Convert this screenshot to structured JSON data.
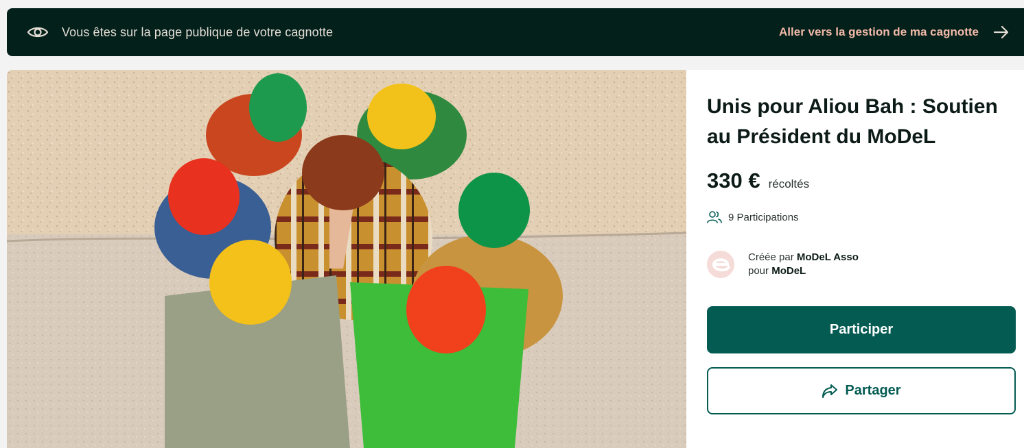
{
  "banner": {
    "message": "Vous êtes sur la page publique de votre cagnotte",
    "manage_link": "Aller vers la gestion de ma cagnotte",
    "icons": {
      "left": "eye-icon",
      "right": "arrow-right-icon"
    }
  },
  "hero": {
    "image": "group-in-colorful-bucket-hats-photo"
  },
  "campaign": {
    "title": "Unis pour Aliou Bah : Soutien au Président du MoDeL",
    "amount": "330 €",
    "amount_suffix": "récoltés",
    "participations": "9 Participations",
    "creator_prefix": "Créée par",
    "creator_name": "MoDeL Asso",
    "for_prefix": "pour",
    "for_name": "MoDeL",
    "participate_label": "Participer",
    "share_label": "Partager"
  },
  "colors": {
    "banner_bg": "#03201a",
    "banner_link": "#f2b9a8",
    "primary": "#035b52",
    "avatar_bg": "#f6dcd8"
  }
}
